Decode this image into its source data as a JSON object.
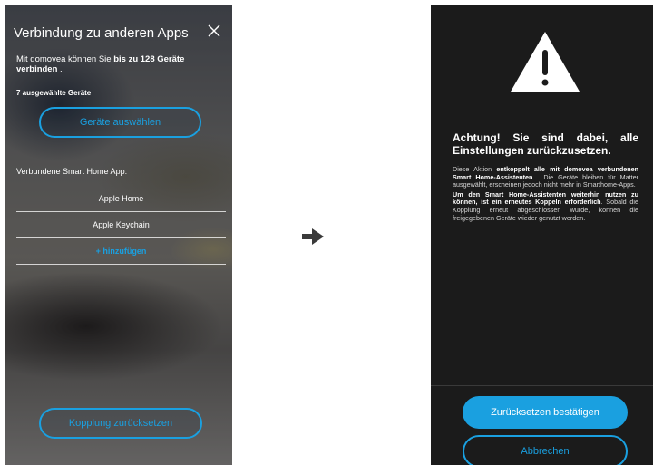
{
  "left": {
    "title": "Verbindung zu anderen Apps",
    "intro_prefix": "Mit domovea können Sie ",
    "intro_bold": "bis zu 128 Geräte verbinden",
    "intro_suffix": " .",
    "selected_count": "7 ausgewählte Geräte",
    "select_button": "Geräte auswählen",
    "connected_label": "Verbundene Smart Home App:",
    "apps": [
      "Apple Home",
      "Apple Keychain"
    ],
    "add_label": "+ hinzufügen",
    "reset_button": "Kopplung zurücksetzen"
  },
  "right": {
    "title": "Achtung! Sie sind dabei, alle Einstellungen zurückzusetzen.",
    "p1_prefix": "Diese Aktion ",
    "p1_bold": "entkoppelt alle mit domovea verbundenen Smart Home-Assistenten",
    "p1_suffix": " . Die Geräte bleiben für Matter ausgewählt, erscheinen jedoch nicht mehr in Smarthome-Apps.",
    "p2_bold": "Um den Smart Home-Assistenten weiterhin nutzen zu können, ist ein erneutes Koppeln erforderlich",
    "p2_suffix": ". Sobald die Kopplung erneut abgeschlossen wurde, können die freigegebenen Geräte wieder genutzt werden.",
    "confirm_button": "Zurücksetzen bestätigen",
    "cancel_button": "Abbrechen"
  },
  "icons": {
    "close": "close-icon",
    "arrow": "arrow-right-icon",
    "warning": "warning-triangle-icon"
  },
  "colors": {
    "accent": "#1aa0e0",
    "dark_bg": "#1b1b1b"
  }
}
